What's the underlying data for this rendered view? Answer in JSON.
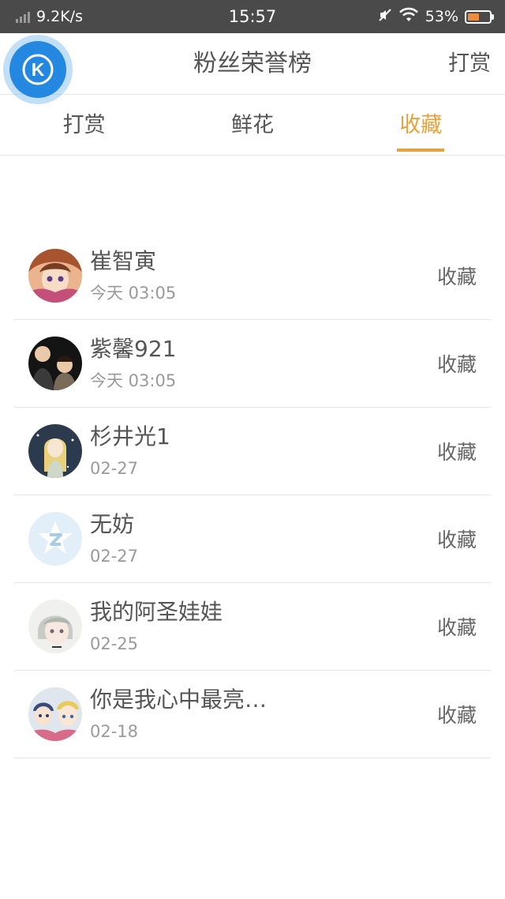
{
  "status_bar": {
    "net_speed": "9.2K/s",
    "time": "15:57",
    "battery": "53%",
    "battery_level": 0.53,
    "icons": [
      "signal-icon",
      "mute-icon",
      "wifi-icon",
      "battery-icon"
    ]
  },
  "header": {
    "title": "粉丝荣誉榜",
    "action_label": "打赏",
    "float_button_letter": "K",
    "accent_color": "#2588e0"
  },
  "tabs": [
    {
      "label": "打赏",
      "active": false
    },
    {
      "label": "鲜花",
      "active": false
    },
    {
      "label": "收藏",
      "active": true
    }
  ],
  "active_tab_color": "#e6a23c",
  "list": {
    "items": [
      {
        "name": "崔智寅",
        "time": "今天 03:05",
        "action": "收藏",
        "avatar": "anime-girl-avatar"
      },
      {
        "name": "紫馨921",
        "time": "今天 03:05",
        "action": "收藏",
        "avatar": "couple-photo-avatar"
      },
      {
        "name": "杉井光1",
        "time": "02-27",
        "action": "收藏",
        "avatar": "anime-blonde-avatar"
      },
      {
        "name": "无妨",
        "time": "02-27",
        "action": "收藏",
        "avatar": "default-star-avatar"
      },
      {
        "name": "我的阿圣娃娃",
        "time": "02-25",
        "action": "收藏",
        "avatar": "grey-hair-avatar"
      },
      {
        "name": "你是我心中最亮…",
        "time": "02-18",
        "action": "收藏",
        "avatar": "cartoon-kids-avatar"
      }
    ]
  }
}
